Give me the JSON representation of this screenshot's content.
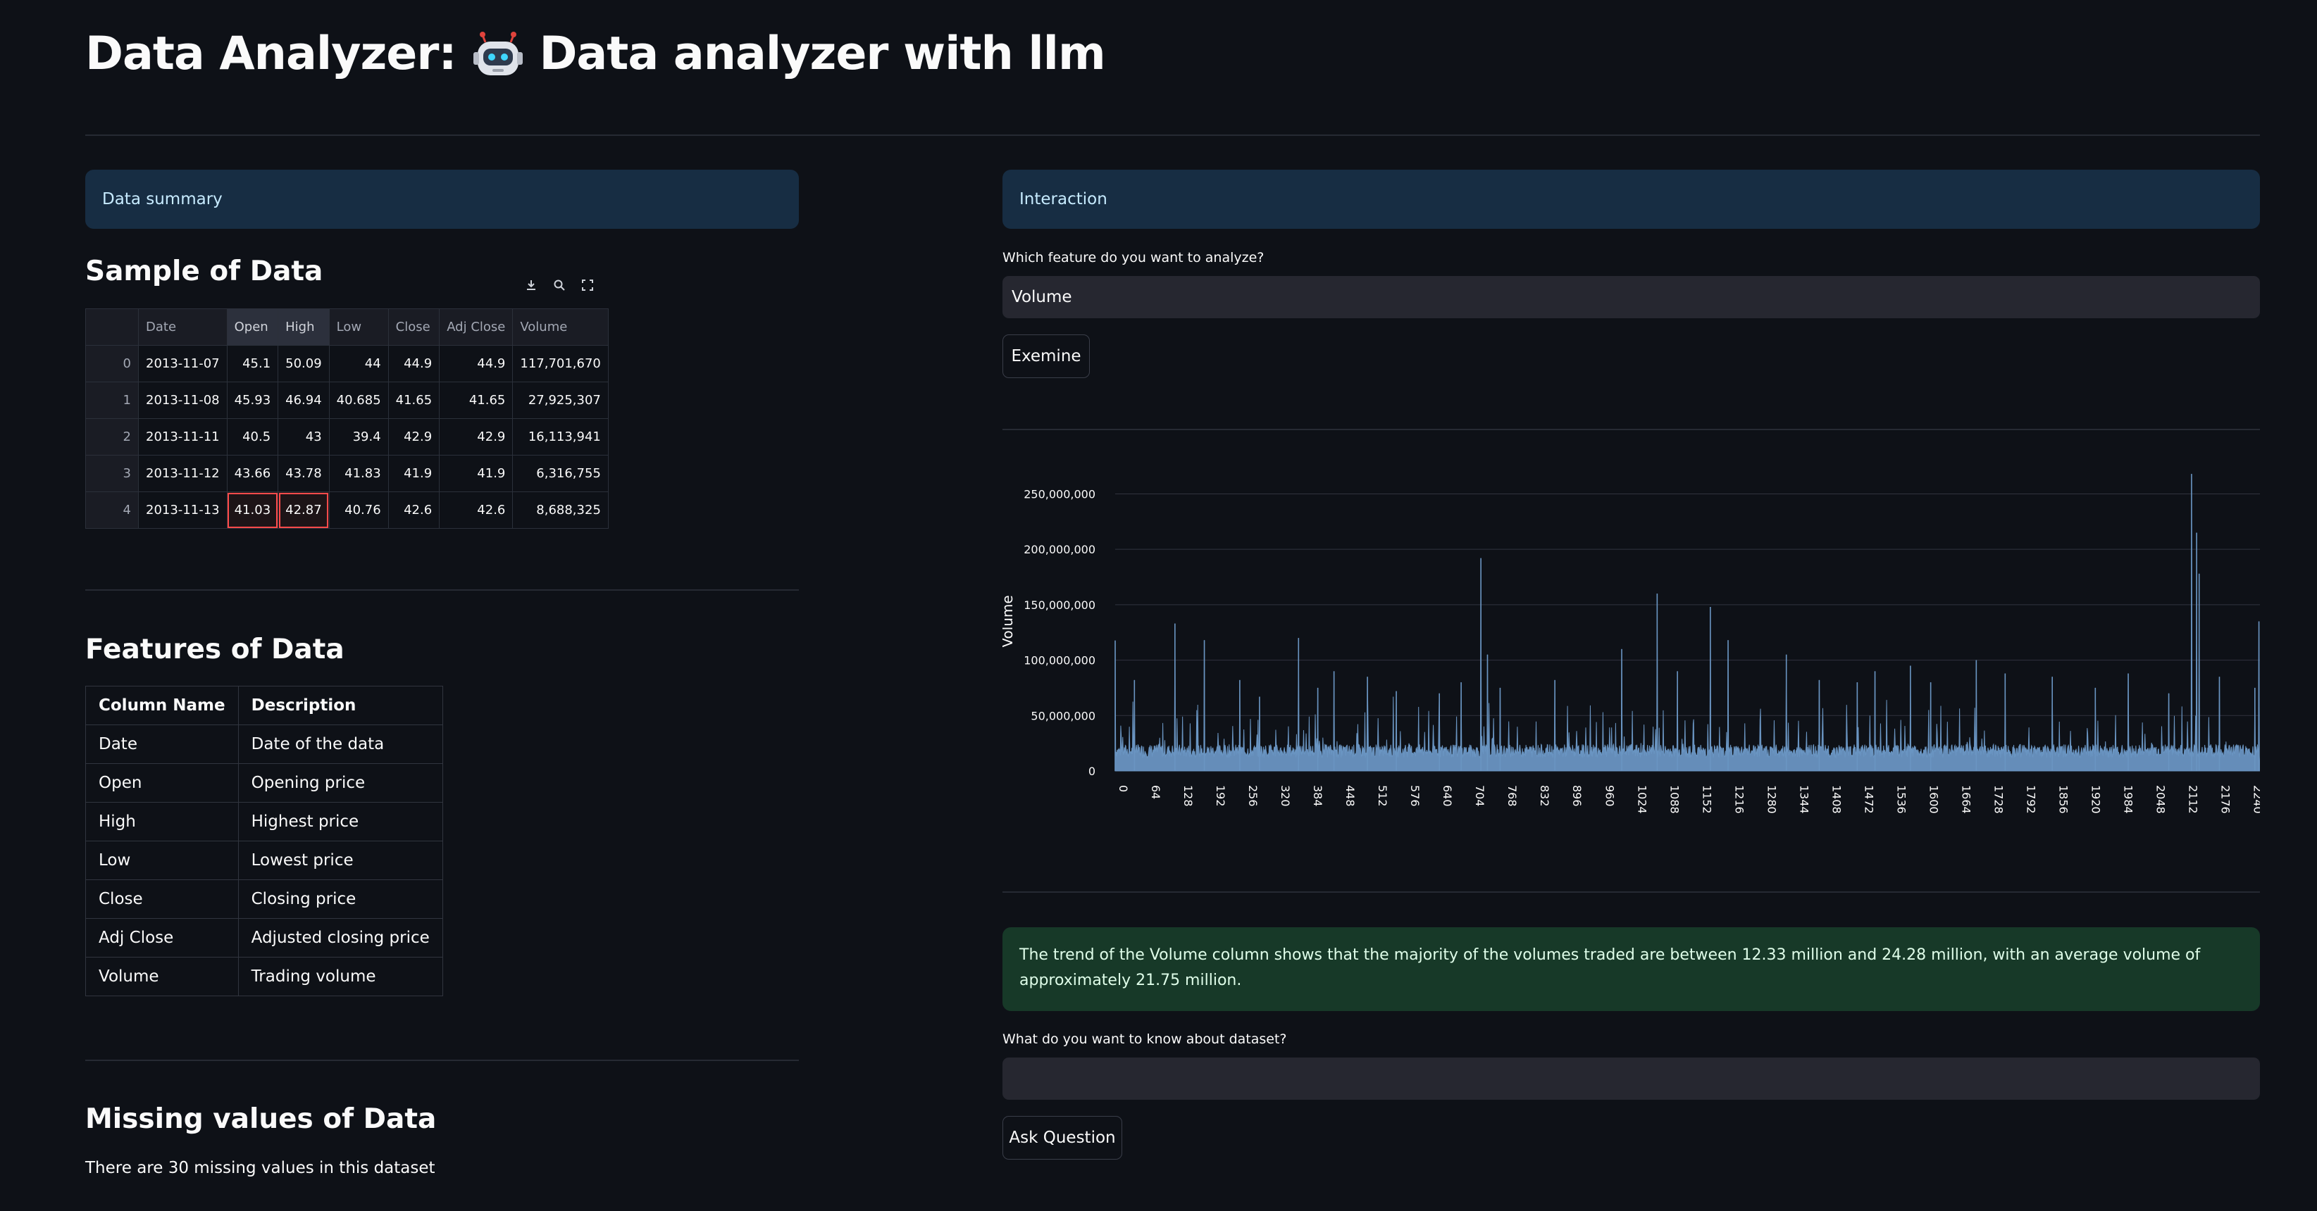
{
  "title": "Data Analyzer:  Data analyzer with llm",
  "title_parts": {
    "prefix": "Data Analyzer:",
    "suffix": "Data analyzer with llm",
    "icon": "robot-icon"
  },
  "left": {
    "summary_box": "Data summary",
    "sample_heading": "Sample of Data",
    "sample_table": {
      "columns": [
        "Date",
        "Open",
        "High",
        "Low",
        "Close",
        "Adj Close",
        "Volume"
      ],
      "rows": [
        {
          "index": "0",
          "cells": [
            "2013-11-07",
            "45.1",
            "50.09",
            "44",
            "44.9",
            "44.9",
            "117,701,670"
          ]
        },
        {
          "index": "1",
          "cells": [
            "2013-11-08",
            "45.93",
            "46.94",
            "40.685",
            "41.65",
            "41.65",
            "27,925,307"
          ]
        },
        {
          "index": "2",
          "cells": [
            "2013-11-11",
            "40.5",
            "43",
            "39.4",
            "42.9",
            "42.9",
            "16,113,941"
          ]
        },
        {
          "index": "3",
          "cells": [
            "2013-11-12",
            "43.66",
            "43.78",
            "41.83",
            "41.9",
            "41.9",
            "6,316,755"
          ]
        },
        {
          "index": "4",
          "cells": [
            "2013-11-13",
            "41.03",
            "42.87",
            "40.76",
            "42.6",
            "42.6",
            "8,688,325"
          ]
        }
      ]
    },
    "features_heading": "Features of Data",
    "features_table": {
      "headers": [
        "Column Name",
        "Description"
      ],
      "rows": [
        [
          "Date",
          "Date of the data"
        ],
        [
          "Open",
          "Opening price"
        ],
        [
          "High",
          "Highest price"
        ],
        [
          "Low",
          "Lowest price"
        ],
        [
          "Close",
          "Closing price"
        ],
        [
          "Adj Close",
          "Adjusted closing price"
        ],
        [
          "Volume",
          "Trading volume"
        ]
      ]
    },
    "missing_heading": "Missing values of Data",
    "missing_text": "There are 30 missing values in this dataset"
  },
  "right": {
    "interaction_box": "Interaction",
    "feature_label": "Which feature do you want to analyze?",
    "feature_value": "Volume",
    "examine_button": "Exemine",
    "insight_text": "The trend of the Volume column shows that the majority of the volumes traded are between 12.33 million and 24.28 million, with an average volume of approximately 21.75 million.",
    "question_label": "What do you want to know about dataset?",
    "question_value": "",
    "ask_button": "Ask Question"
  },
  "colors": {
    "bar": "#6a95c2",
    "info_bg": "#172d43",
    "success_bg": "#173928",
    "background": "#0e1117"
  },
  "chart_data": {
    "type": "bar",
    "ylabel": "Volume",
    "xlabel": "",
    "ylim": [
      0,
      270000000
    ],
    "y_ticks": [
      "0",
      "50,000,000",
      "100,000,000",
      "150,000,000",
      "200,000,000",
      "250,000,000"
    ],
    "y_tick_values": [
      0,
      50000000,
      100000000,
      150000000,
      200000000,
      250000000
    ],
    "x_ticks": [
      "0",
      "64",
      "128",
      "192",
      "256",
      "320",
      "384",
      "448",
      "512",
      "576",
      "640",
      "704",
      "768",
      "832",
      "896",
      "960",
      "1024",
      "1088",
      "1152",
      "1216",
      "1280",
      "1344",
      "1408",
      "1472",
      "1536",
      "1600",
      "1664",
      "1728",
      "1792",
      "1856",
      "1920",
      "1984",
      "2048",
      "2112",
      "2176",
      "2240"
    ],
    "x_range": [
      0,
      2260
    ],
    "n_points": 2260,
    "grid": true,
    "baseline_range_millions": [
      12,
      24
    ],
    "notable_peaks": [
      {
        "x": 0,
        "y": 117701670
      },
      {
        "x": 38,
        "y": 82000000
      },
      {
        "x": 118,
        "y": 133000000
      },
      {
        "x": 176,
        "y": 118000000
      },
      {
        "x": 246,
        "y": 82000000
      },
      {
        "x": 285,
        "y": 67000000
      },
      {
        "x": 362,
        "y": 120000000
      },
      {
        "x": 400,
        "y": 75000000
      },
      {
        "x": 432,
        "y": 90000000
      },
      {
        "x": 498,
        "y": 85000000
      },
      {
        "x": 555,
        "y": 72000000
      },
      {
        "x": 640,
        "y": 70000000
      },
      {
        "x": 683,
        "y": 80000000
      },
      {
        "x": 722,
        "y": 192000000
      },
      {
        "x": 735,
        "y": 105000000
      },
      {
        "x": 760,
        "y": 75000000
      },
      {
        "x": 868,
        "y": 82000000
      },
      {
        "x": 1000,
        "y": 110000000
      },
      {
        "x": 1070,
        "y": 160000000
      },
      {
        "x": 1110,
        "y": 90000000
      },
      {
        "x": 1175,
        "y": 148000000
      },
      {
        "x": 1210,
        "y": 118000000
      },
      {
        "x": 1325,
        "y": 105000000
      },
      {
        "x": 1390,
        "y": 82000000
      },
      {
        "x": 1465,
        "y": 80000000
      },
      {
        "x": 1500,
        "y": 90000000
      },
      {
        "x": 1570,
        "y": 95000000
      },
      {
        "x": 1610,
        "y": 80000000
      },
      {
        "x": 1700,
        "y": 100000000
      },
      {
        "x": 1757,
        "y": 88000000
      },
      {
        "x": 1850,
        "y": 85000000
      },
      {
        "x": 1935,
        "y": 75000000
      },
      {
        "x": 2000,
        "y": 88000000
      },
      {
        "x": 2080,
        "y": 70000000
      },
      {
        "x": 2125,
        "y": 268000000
      },
      {
        "x": 2135,
        "y": 215000000
      },
      {
        "x": 2140,
        "y": 178000000
      },
      {
        "x": 2180,
        "y": 85000000
      },
      {
        "x": 2250,
        "y": 75000000
      },
      {
        "x": 2258,
        "y": 135000000
      }
    ]
  }
}
